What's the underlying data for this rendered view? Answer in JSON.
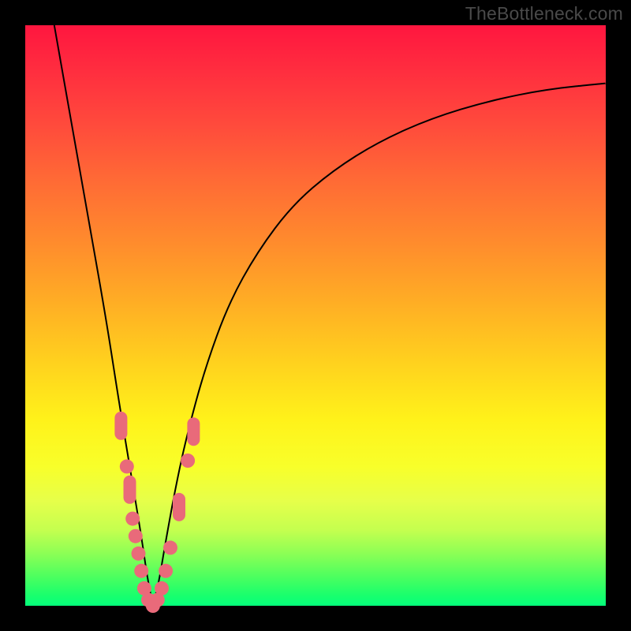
{
  "watermark": "TheBottleneck.com",
  "colors": {
    "frame": "#000000",
    "gradient_top": "#ff163f",
    "gradient_bottom": "#04ff7a",
    "curve": "#000000",
    "marker": "#e96a7a"
  },
  "chart_data": {
    "type": "line",
    "title": "",
    "xlabel": "",
    "ylabel": "",
    "xlim": [
      0,
      100
    ],
    "ylim": [
      0,
      100
    ],
    "grid": false,
    "legend": false,
    "curve_note": "V-shaped bottleneck curve; left branch descends steeply from top-left, right branch rises asymptotically toward top-right. Minimum near x≈22, y≈0.",
    "series": [
      {
        "name": "bottleneck-curve",
        "x": [
          5,
          8,
          11,
          14,
          16,
          18,
          20,
          21,
          22,
          23,
          24,
          26,
          28,
          31,
          35,
          40,
          46,
          53,
          61,
          70,
          80,
          90,
          100
        ],
        "y": [
          100,
          83,
          66,
          49,
          36,
          24,
          12,
          5,
          0,
          4,
          10,
          21,
          30,
          41,
          52,
          61,
          69,
          75,
          80,
          84,
          87,
          89,
          90
        ]
      }
    ],
    "markers_note": "Salmon-colored rounded markers clustered along the lower portion of both curve branches near the trough.",
    "markers": [
      {
        "x": 16.5,
        "y": 31,
        "shape": "pill-v"
      },
      {
        "x": 17.5,
        "y": 24,
        "shape": "round"
      },
      {
        "x": 18.0,
        "y": 20,
        "shape": "pill-v"
      },
      {
        "x": 18.5,
        "y": 15,
        "shape": "round"
      },
      {
        "x": 19.0,
        "y": 12,
        "shape": "round"
      },
      {
        "x": 19.5,
        "y": 9,
        "shape": "round"
      },
      {
        "x": 20.0,
        "y": 6,
        "shape": "round"
      },
      {
        "x": 20.5,
        "y": 3,
        "shape": "round"
      },
      {
        "x": 21.2,
        "y": 1,
        "shape": "round"
      },
      {
        "x": 22.0,
        "y": 0,
        "shape": "round"
      },
      {
        "x": 22.8,
        "y": 1,
        "shape": "round"
      },
      {
        "x": 23.5,
        "y": 3,
        "shape": "round"
      },
      {
        "x": 24.2,
        "y": 6,
        "shape": "round"
      },
      {
        "x": 25.0,
        "y": 10,
        "shape": "round"
      },
      {
        "x": 26.5,
        "y": 17,
        "shape": "pill-v"
      },
      {
        "x": 28.0,
        "y": 25,
        "shape": "round"
      },
      {
        "x": 29.0,
        "y": 30,
        "shape": "pill-v"
      }
    ]
  }
}
